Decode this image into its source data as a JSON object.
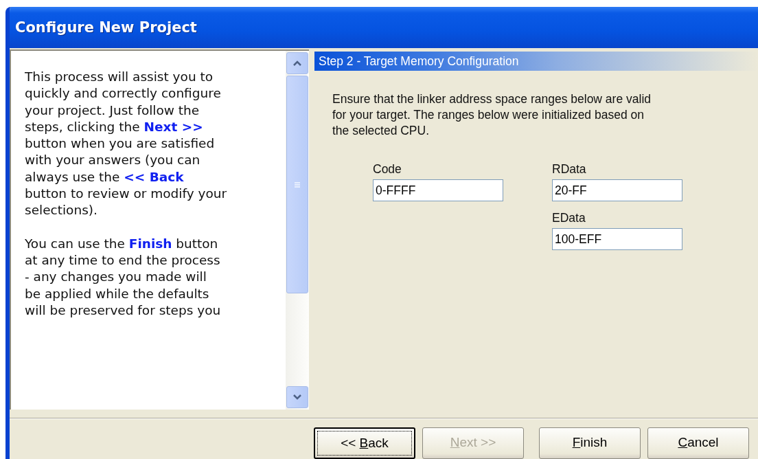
{
  "window": {
    "title": "Configure New Project"
  },
  "help_text": {
    "paragraphs": [
      [
        "This process will assist you to",
        "quickly and correctly configure",
        "your project. Just follow the",
        "steps, clicking the **Next >>**",
        "button when you are satisfied",
        "with your answers (you can",
        "always use the **<< Back**",
        "button to review or modify your",
        "selections)."
      ],
      [
        "You can use the **Finish** button",
        "at any time to end the process",
        "- any changes you made will",
        "be applied while the defaults",
        "will be preserved for steps you"
      ]
    ]
  },
  "step": {
    "title": "Step 2 - Target Memory Configuration",
    "description": [
      "Ensure that the linker address space ranges below are valid",
      "for your target.  The ranges below were initialized based on",
      "the selected CPU."
    ],
    "field_columns": [
      [
        {
          "label": "Code",
          "value": "0-FFFF"
        }
      ],
      [
        {
          "label": "RData",
          "value": "20-FF"
        },
        {
          "label": "EData",
          "value": "100-EFF"
        }
      ]
    ]
  },
  "buttons": [
    {
      "label_before": "<< ",
      "access_key": "B",
      "label_after": "ack",
      "focused": true,
      "disabled": false
    },
    {
      "access_key": "N",
      "label_after": "ext >>",
      "focused": false,
      "disabled": true
    },
    {
      "access_key": "F",
      "label_after": "inish",
      "focused": false,
      "disabled": false
    },
    {
      "access_key": "C",
      "label_after": "ancel",
      "focused": false,
      "disabled": false
    }
  ]
}
